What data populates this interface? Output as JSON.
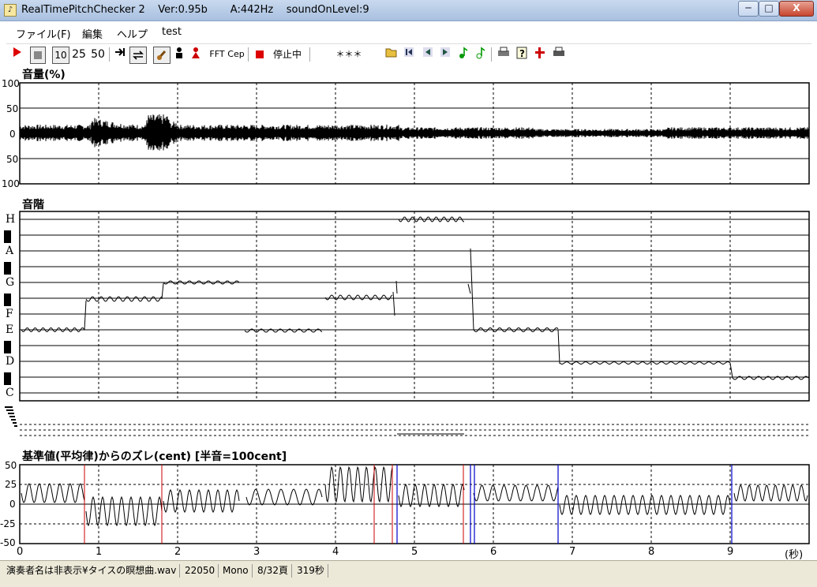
{
  "window": {
    "title": "RealTimePitchChecker 2    Ver:0.95b       A:442Hz    soundOnLevel:9",
    "btn_minimize": "─",
    "btn_maximize": "□",
    "btn_close": "X"
  },
  "menu": [
    {
      "label": "ファイル(F)"
    },
    {
      "label": "編集"
    },
    {
      "label": "ヘルプ"
    },
    {
      "label": "test"
    }
  ],
  "toolbar": {
    "btn_10": "10",
    "btn_25": "25",
    "btn_50": "50",
    "btn_fft": "FFT",
    "btn_cep": "Cep",
    "status": "停止中",
    "field": "＊＊＊"
  },
  "volume_panel": {
    "title": "音量(%)",
    "y_ticks": [
      "100",
      "50",
      "0",
      "50",
      "100"
    ]
  },
  "scale_panel": {
    "title": "音階",
    "notes": [
      "H",
      "A",
      "G",
      "F",
      "E",
      "D",
      "C"
    ]
  },
  "dev_panel": {
    "title": "基準値(平均律)からのズレ(cent) [半音=100cent]",
    "y_ticks": [
      "50",
      "25",
      "0",
      "-25",
      "-50"
    ]
  },
  "x_axis": {
    "ticks": [
      "0",
      "1",
      "2",
      "3",
      "4",
      "5",
      "6",
      "7",
      "8",
      "9"
    ],
    "unit": "(秒)"
  },
  "status": {
    "file": "演奏者名は非表示¥タイスの瞑想曲.wav",
    "rate": "22050",
    "channel": "Mono",
    "page": "8/32頁",
    "duration": "319秒"
  },
  "colors": {
    "accent_red": "#cc0000",
    "accent_blue": "#0000cc",
    "grid_dash": "#000000"
  }
}
